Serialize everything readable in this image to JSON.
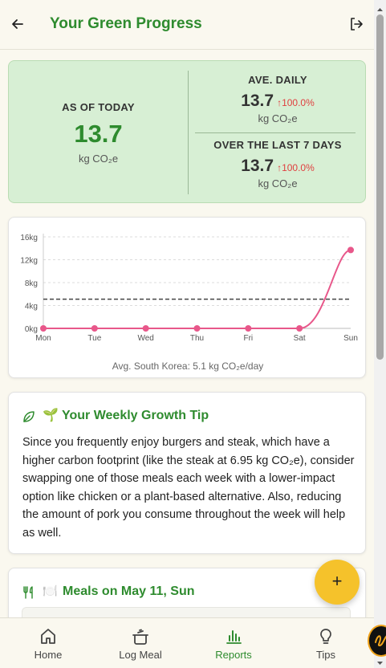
{
  "header": {
    "title": "Your Green Progress",
    "back_icon": "back-arrow-icon",
    "logout_icon": "logout-icon"
  },
  "summary": {
    "today": {
      "label": "AS OF TODAY",
      "value": "13.7",
      "unit": "kg CO₂e"
    },
    "daily": {
      "label": "AVE. DAILY",
      "value": "13.7",
      "change": "↑100.0%",
      "unit": "kg CO₂e"
    },
    "week": {
      "label": "OVER THE LAST 7 DAYS",
      "value": "13.7",
      "change": "↑100.0%",
      "unit": "kg CO₂e"
    },
    "colors": {
      "accent": "#2e8b2e",
      "increase": "#e04040",
      "card_bg": "#d7efd4"
    }
  },
  "chart_data": {
    "type": "line",
    "categories": [
      "Mon",
      "Tue",
      "Wed",
      "Thu",
      "Fri",
      "Sat",
      "Sun"
    ],
    "values": [
      0,
      0,
      0,
      0,
      0,
      0,
      13.7
    ],
    "y_ticks": [
      "0kg",
      "4kg",
      "8kg",
      "12kg",
      "16kg"
    ],
    "y_tick_values": [
      0,
      4,
      8,
      12,
      16
    ],
    "ylim": [
      0,
      16
    ],
    "reference_line": 5.1,
    "caption": "Avg. South Korea: 5.1 kg CO₂e/day",
    "line_color": "#e8578a",
    "grid": true
  },
  "tip": {
    "leaf_icon": "leaf-icon",
    "emoji": "🌱",
    "title": "Your Weekly Growth Tip",
    "body": "Since you frequently enjoy burgers and steak, which have a higher carbon footprint (like the steak at 6.95 kg CO₂e), consider swapping one of those meals each week with a lower-impact option like chicken or a plant-based alternative. Also, reducing the amount of pork you consume throughout the week will help as well."
  },
  "meals": {
    "icon": "fork-knife-icon",
    "emoji": "🍽️",
    "title": "Meals on May 11, Sun"
  },
  "fab": {
    "label": "+"
  },
  "nav": {
    "items": [
      {
        "label": "Home",
        "icon": "home-icon"
      },
      {
        "label": "Log Meal",
        "icon": "pot-icon"
      },
      {
        "label": "Reports",
        "icon": "bar-chart-icon"
      },
      {
        "label": "Tips",
        "icon": "lightbulb-icon"
      }
    ]
  }
}
